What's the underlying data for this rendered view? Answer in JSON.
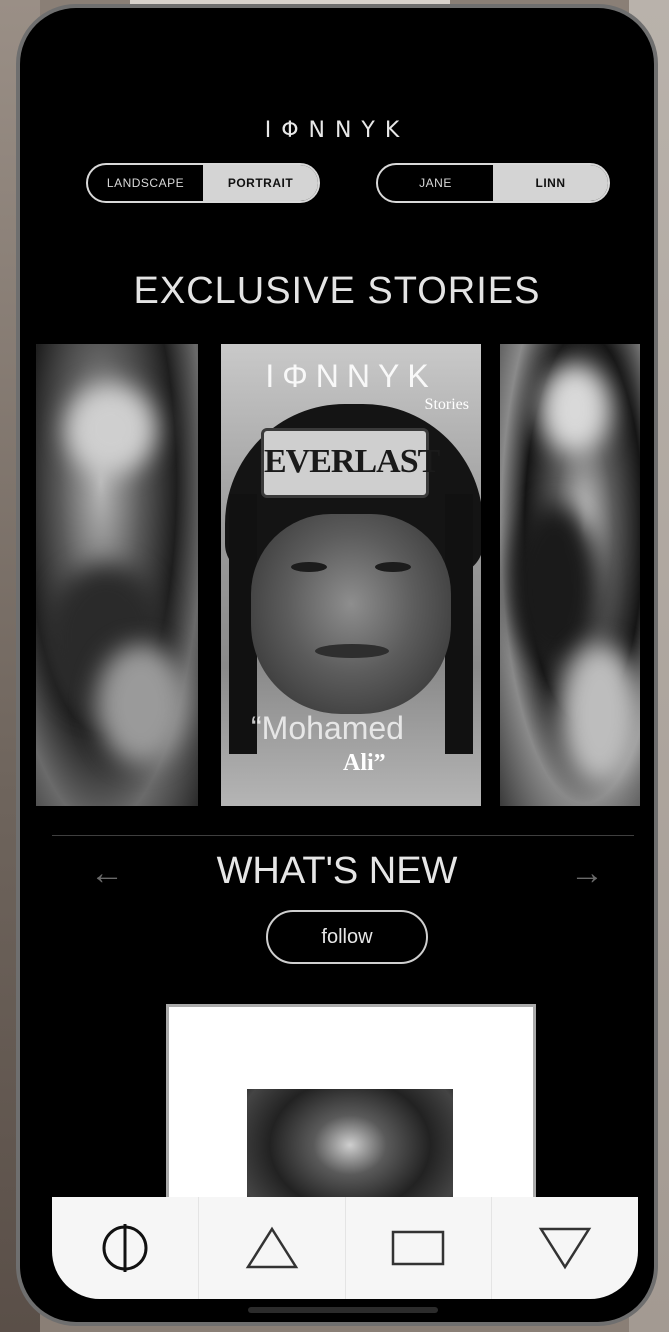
{
  "app": {
    "logo": "IΦNNYK"
  },
  "orientation_toggle": {
    "options": [
      "LANDSCAPE",
      "PORTRAIT"
    ],
    "selected": "PORTRAIT"
  },
  "person_toggle": {
    "options": [
      "JANE",
      "LINN"
    ],
    "selected": "LINN"
  },
  "stories": {
    "heading": "EXCLUSIVE STORIES",
    "featured": {
      "brand": "IΦNNYK",
      "label": "Stories",
      "helmet_text": "EVERLAST",
      "quote_line1": "“Mohamed",
      "quote_line2": "Ali”"
    }
  },
  "whats_new": {
    "heading": "WHAT'S NEW",
    "follow_label": "follow"
  },
  "nav": {
    "items": [
      "phi-icon",
      "triangle-up-icon",
      "rectangle-icon",
      "triangle-down-icon"
    ]
  }
}
